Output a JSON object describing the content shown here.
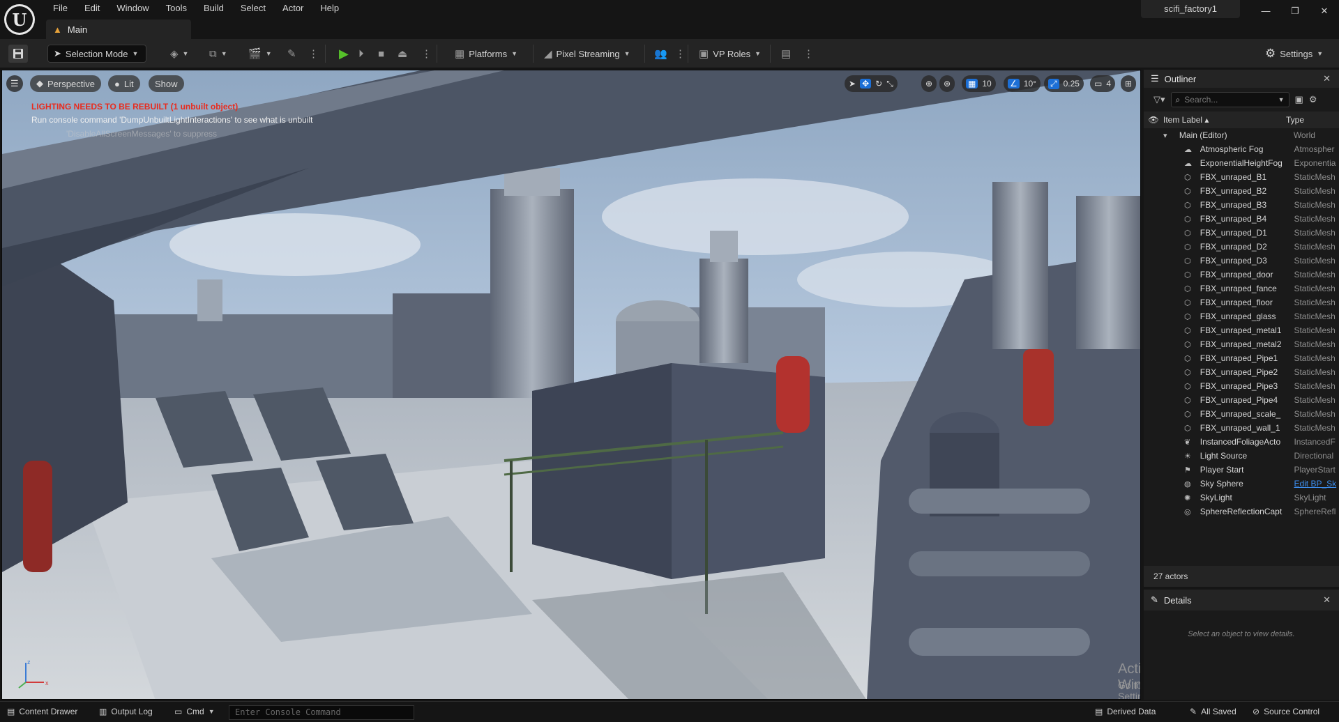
{
  "menu": [
    "File",
    "Edit",
    "Window",
    "Tools",
    "Build",
    "Select",
    "Actor",
    "Help"
  ],
  "tab": {
    "label": "Main"
  },
  "project_name": "scifi_factory1",
  "window_controls": {
    "minimize": "—",
    "restore": "❐",
    "close": "✕"
  },
  "toolbar": {
    "selection_mode": "Selection Mode",
    "platforms": "Platforms",
    "pixel_streaming": "Pixel Streaming",
    "vp_roles": "VP Roles",
    "settings": "Settings"
  },
  "viewport": {
    "perspective": "Perspective",
    "lit": "Lit",
    "show": "Show",
    "grid_snap": "10",
    "rotation_snap": "10°",
    "scale_snap": "0.25",
    "camera_speed": "4",
    "warning_title": "LIGHTING NEEDS TO BE REBUILT (1 unbuilt object)",
    "warning_hint": "Run console command 'DumpUnbuiltLightInteractions' to see what is unbuilt",
    "warning_faded": "'DisableAllScreenMessages' to suppress",
    "activate_title": "Activate Windows",
    "activate_hint": "Go to Settings to activate Windows."
  },
  "outliner": {
    "title": "Outliner",
    "search_placeholder": "Search...",
    "col_label": "Item Label",
    "col_type": "Type",
    "rows": [
      {
        "label": "Main (Editor)",
        "type": "World",
        "icon": "world-icon",
        "indent": 1
      },
      {
        "label": "Atmospheric Fog",
        "type": "Atmospher",
        "icon": "fog-icon",
        "indent": 2
      },
      {
        "label": "ExponentialHeightFog",
        "type": "Exponentia",
        "icon": "fog-icon",
        "indent": 2
      },
      {
        "label": "FBX_unraped_B1",
        "type": "StaticMesh",
        "icon": "mesh-icon",
        "indent": 2
      },
      {
        "label": "FBX_unraped_B2",
        "type": "StaticMesh",
        "icon": "mesh-icon",
        "indent": 2
      },
      {
        "label": "FBX_unraped_B3",
        "type": "StaticMesh",
        "icon": "mesh-icon",
        "indent": 2
      },
      {
        "label": "FBX_unraped_B4",
        "type": "StaticMesh",
        "icon": "mesh-icon",
        "indent": 2
      },
      {
        "label": "FBX_unraped_D1",
        "type": "StaticMesh",
        "icon": "mesh-icon",
        "indent": 2
      },
      {
        "label": "FBX_unraped_D2",
        "type": "StaticMesh",
        "icon": "mesh-icon",
        "indent": 2
      },
      {
        "label": "FBX_unraped_D3",
        "type": "StaticMesh",
        "icon": "mesh-icon",
        "indent": 2
      },
      {
        "label": "FBX_unraped_door",
        "type": "StaticMesh",
        "icon": "mesh-icon",
        "indent": 2
      },
      {
        "label": "FBX_unraped_fance",
        "type": "StaticMesh",
        "icon": "mesh-icon",
        "indent": 2
      },
      {
        "label": "FBX_unraped_floor",
        "type": "StaticMesh",
        "icon": "mesh-icon",
        "indent": 2
      },
      {
        "label": "FBX_unraped_glass",
        "type": "StaticMesh",
        "icon": "mesh-icon",
        "indent": 2
      },
      {
        "label": "FBX_unraped_metal1",
        "type": "StaticMesh",
        "icon": "mesh-icon",
        "indent": 2
      },
      {
        "label": "FBX_unraped_metal2",
        "type": "StaticMesh",
        "icon": "mesh-icon",
        "indent": 2
      },
      {
        "label": "FBX_unraped_Pipe1",
        "type": "StaticMesh",
        "icon": "mesh-icon",
        "indent": 2
      },
      {
        "label": "FBX_unraped_Pipe2",
        "type": "StaticMesh",
        "icon": "mesh-icon",
        "indent": 2
      },
      {
        "label": "FBX_unraped_Pipe3",
        "type": "StaticMesh",
        "icon": "mesh-icon",
        "indent": 2
      },
      {
        "label": "FBX_unraped_Pipe4",
        "type": "StaticMesh",
        "icon": "mesh-icon",
        "indent": 2
      },
      {
        "label": "FBX_unraped_scale_",
        "type": "StaticMesh",
        "icon": "mesh-icon",
        "indent": 2
      },
      {
        "label": "FBX_unraped_wall_1",
        "type": "StaticMesh",
        "icon": "mesh-icon",
        "indent": 2
      },
      {
        "label": "InstancedFoliageActo",
        "type": "InstancedF",
        "icon": "foliage-icon",
        "indent": 2
      },
      {
        "label": "Light Source",
        "type": "Directional",
        "icon": "sun-icon",
        "indent": 2
      },
      {
        "label": "Player Start",
        "type": "PlayerStart",
        "icon": "player-start-icon",
        "indent": 2
      },
      {
        "label": "Sky Sphere",
        "type": "Edit BP_Sk",
        "icon": "sphere-icon",
        "indent": 2,
        "link": true
      },
      {
        "label": "SkyLight",
        "type": "SkyLight",
        "icon": "skylight-icon",
        "indent": 2
      },
      {
        "label": "SphereReflectionCapt",
        "type": "SphereRefl",
        "icon": "reflection-icon",
        "indent": 2
      }
    ],
    "actor_count": "27 actors"
  },
  "details": {
    "title": "Details",
    "empty_message": "Select an object to view details."
  },
  "statusbar": {
    "content_drawer": "Content Drawer",
    "output_log": "Output Log",
    "cmd": "Cmd",
    "console_placeholder": "Enter Console Command",
    "derived_data": "Derived Data",
    "all_saved": "All Saved",
    "source_control": "Source Control"
  },
  "colors": {
    "accent_blue": "#1c6fd6",
    "play_green": "#56c02a",
    "warning_red": "#e82b1e",
    "tab_icon_orange": "#e8a33a"
  }
}
